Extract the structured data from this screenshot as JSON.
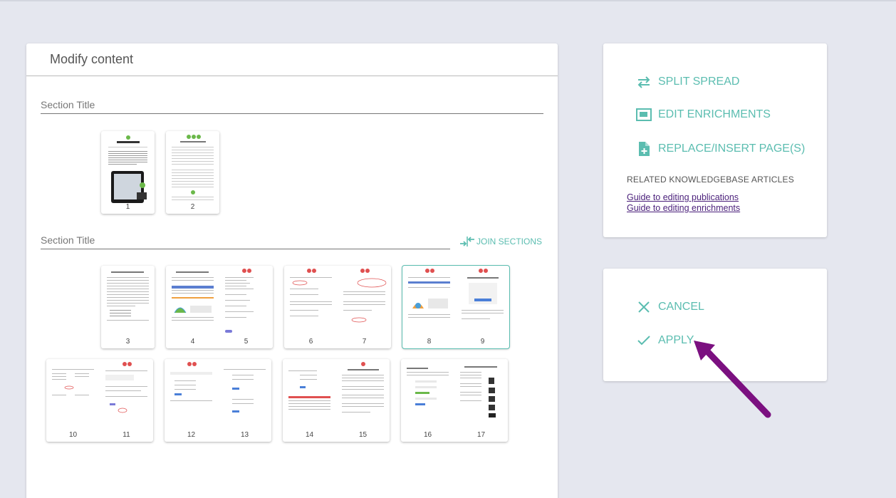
{
  "main": {
    "title": "Modify content",
    "sections": [
      {
        "title": "Section Title"
      },
      {
        "title": "Section Title",
        "join_label": "JOIN SECTIONS"
      }
    ],
    "pages": [
      "1",
      "2",
      "3",
      "4",
      "5",
      "6",
      "7",
      "8",
      "9",
      "10",
      "11",
      "12",
      "13",
      "14",
      "15",
      "16",
      "17"
    ]
  },
  "actions": {
    "split_spread": "SPLIT SPREAD",
    "edit_enrichments": "EDIT ENRICHMENTS",
    "replace_insert": "REPLACE/INSERT PAGE(S)",
    "kb_heading": "RELATED KNOWLEDGEBASE ARTICLES",
    "kb_links": [
      "Guide to editing publications",
      "Guide to editing enrichments"
    ]
  },
  "confirm": {
    "cancel": "CANCEL",
    "apply": "APPLY"
  },
  "colors": {
    "accent": "#5bbdb0",
    "link": "#4a1f7a",
    "arrow": "#7b1080"
  }
}
